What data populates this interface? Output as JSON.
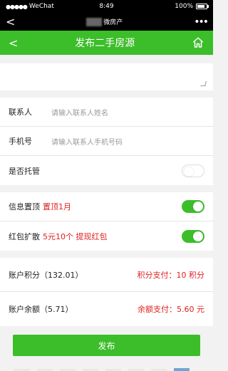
{
  "status": {
    "carrier": "WeChat",
    "time": "8:49",
    "battery": "100%"
  },
  "wechat": {
    "back_icon": "chevron-left-icon",
    "title": "微房产",
    "more": "•••"
  },
  "appbar": {
    "title": "发布二手房源",
    "back_icon": "chevron-left-icon",
    "home_icon": "home-icon"
  },
  "textarea": {
    "value": ""
  },
  "contact": {
    "name_label": "联系人",
    "name_placeholder": "请输入联系人姓名",
    "phone_label": "手机号",
    "phone_placeholder": "请输入联系人手机号码"
  },
  "custody": {
    "label": "是否托管",
    "on": false
  },
  "top_info": {
    "label": "信息置顶",
    "highlight": "置顶1月",
    "on": true
  },
  "red_packet": {
    "label": "红包扩散",
    "highlight": "5元10个 提现红包",
    "on": true
  },
  "account": {
    "points_label": "账户积分（132.01）",
    "points_pay": "积分支付：10 积分",
    "balance_label": "账户余额（5.71）",
    "balance_pay": "余额支付：5.60 元"
  },
  "submit": {
    "label": "发布"
  },
  "colors": {
    "accent": "#3cbd2a",
    "red": "#e02020"
  }
}
